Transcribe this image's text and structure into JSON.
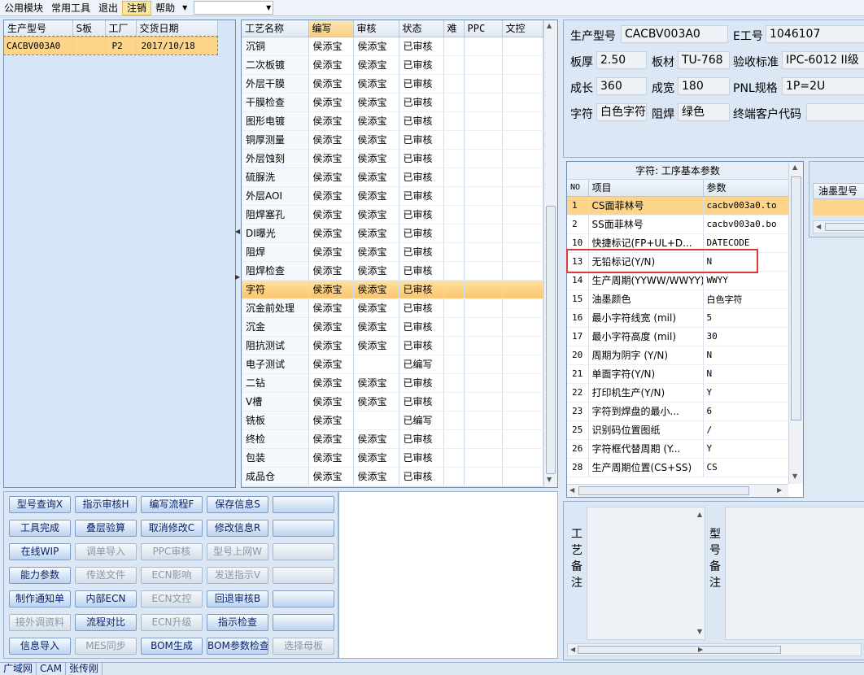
{
  "menu": {
    "items": [
      "公用模块",
      "常用工具",
      "退出",
      "注销",
      "帮助"
    ],
    "active_index": 3,
    "combo_value": ""
  },
  "orders": {
    "columns": [
      "生产型号",
      "S板",
      "工厂",
      "交货日期"
    ],
    "rows": [
      [
        "CACBV003A0",
        "",
        "P2",
        "2017/10/18"
      ]
    ]
  },
  "process": {
    "columns": [
      "工艺名称",
      "编写",
      "审核",
      "状态",
      "难",
      "PPC",
      "文控"
    ],
    "selected_index": 14,
    "rows": [
      [
        "沉铜",
        "侯添宝",
        "侯添宝",
        "已审核",
        "",
        "",
        ""
      ],
      [
        "二次板镀",
        "侯添宝",
        "侯添宝",
        "已审核",
        "",
        "",
        ""
      ],
      [
        "外层干膜",
        "侯添宝",
        "侯添宝",
        "已审核",
        "",
        "",
        ""
      ],
      [
        "干膜检查",
        "侯添宝",
        "侯添宝",
        "已审核",
        "",
        "",
        ""
      ],
      [
        "图形电镀",
        "侯添宝",
        "侯添宝",
        "已审核",
        "",
        "",
        ""
      ],
      [
        "铜厚测量",
        "侯添宝",
        "侯添宝",
        "已审核",
        "",
        "",
        ""
      ],
      [
        "外层蚀刻",
        "侯添宝",
        "侯添宝",
        "已审核",
        "",
        "",
        ""
      ],
      [
        "硫脲洗",
        "侯添宝",
        "侯添宝",
        "已审核",
        "",
        "",
        ""
      ],
      [
        "外层AOI",
        "侯添宝",
        "侯添宝",
        "已审核",
        "",
        "",
        ""
      ],
      [
        "阻焊塞孔",
        "侯添宝",
        "侯添宝",
        "已审核",
        "",
        "",
        ""
      ],
      [
        "DI曝光",
        "侯添宝",
        "侯添宝",
        "已审核",
        "",
        "",
        ""
      ],
      [
        "阻焊",
        "侯添宝",
        "侯添宝",
        "已审核",
        "",
        "",
        ""
      ],
      [
        "阻焊检查",
        "侯添宝",
        "侯添宝",
        "已审核",
        "",
        "",
        ""
      ],
      [
        "字符",
        "侯添宝",
        "侯添宝",
        "已审核",
        "",
        "",
        ""
      ],
      [
        "沉金前处理",
        "侯添宝",
        "侯添宝",
        "已审核",
        "",
        "",
        ""
      ],
      [
        "沉金",
        "侯添宝",
        "侯添宝",
        "已审核",
        "",
        "",
        ""
      ],
      [
        "阻抗测试",
        "侯添宝",
        "侯添宝",
        "已审核",
        "",
        "",
        ""
      ],
      [
        "电子测试",
        "侯添宝",
        "",
        "已编写",
        "",
        "",
        ""
      ],
      [
        "二钻",
        "侯添宝",
        "侯添宝",
        "已审核",
        "",
        "",
        ""
      ],
      [
        "V槽",
        "侯添宝",
        "侯添宝",
        "已审核",
        "",
        "",
        ""
      ],
      [
        "铣板",
        "侯添宝",
        "",
        "已编写",
        "",
        "",
        ""
      ],
      [
        "终检",
        "侯添宝",
        "侯添宝",
        "已审核",
        "",
        "",
        ""
      ],
      [
        "包装",
        "侯添宝",
        "侯添宝",
        "已审核",
        "",
        "",
        ""
      ],
      [
        "成品仓",
        "侯添宝",
        "侯添宝",
        "已审核",
        "",
        "",
        ""
      ]
    ]
  },
  "buttons": [
    {
      "label": "型号查询X",
      "enabled": true
    },
    {
      "label": "指示审核H",
      "enabled": true
    },
    {
      "label": "编写流程F",
      "enabled": true
    },
    {
      "label": "保存信息S",
      "enabled": true
    },
    {
      "label": "",
      "enabled": true
    },
    {
      "label": "工具完成",
      "enabled": true
    },
    {
      "label": "叠层验算",
      "enabled": true
    },
    {
      "label": "取消修改C",
      "enabled": true
    },
    {
      "label": "修改信息R",
      "enabled": true
    },
    {
      "label": "",
      "enabled": true
    },
    {
      "label": "在线WIP",
      "enabled": true
    },
    {
      "label": "调单导入",
      "enabled": false
    },
    {
      "label": "PPC审核",
      "enabled": false
    },
    {
      "label": "型号上网W",
      "enabled": false
    },
    {
      "label": "",
      "enabled": false
    },
    {
      "label": "能力参数",
      "enabled": true
    },
    {
      "label": "传送文件",
      "enabled": false
    },
    {
      "label": "ECN影响",
      "enabled": false
    },
    {
      "label": "发送指示V",
      "enabled": false
    },
    {
      "label": "",
      "enabled": false
    },
    {
      "label": "制作通知单",
      "enabled": true
    },
    {
      "label": "内部ECN",
      "enabled": true
    },
    {
      "label": "ECN文控",
      "enabled": false
    },
    {
      "label": "回退审核B",
      "enabled": true
    },
    {
      "label": "",
      "enabled": true
    },
    {
      "label": "接外调资料",
      "enabled": false
    },
    {
      "label": "流程对比",
      "enabled": true
    },
    {
      "label": "ECN升级",
      "enabled": false
    },
    {
      "label": "指示检查",
      "enabled": true
    },
    {
      "label": "",
      "enabled": true
    },
    {
      "label": "信息导入",
      "enabled": true
    },
    {
      "label": "MES同步",
      "enabled": false
    },
    {
      "label": "BOM生成",
      "enabled": true
    },
    {
      "label": "BOM参数检查",
      "enabled": true
    },
    {
      "label": "选择母板",
      "enabled": false
    }
  ],
  "info": {
    "model_label": "生产型号",
    "model_value": "CACBV003A0",
    "eno_label": "E工号",
    "eno_value": "1046107",
    "thickness_label": "板厚",
    "thickness_value": "2.50",
    "material_label": "板材",
    "material_value": "TU-768",
    "standard_label": "验收标准",
    "standard_value": "IPC-6012 II级",
    "length_label": "成长",
    "length_value": "360",
    "width_label": "成宽",
    "width_value": "180",
    "pnl_label": "PNL规格",
    "pnl_value": "1P=2U",
    "char_label": "字符",
    "char_value": "白色字符",
    "mask_label": "阻焊",
    "mask_value": "绿色",
    "customer_label": "终端客户代码",
    "customer_value": ""
  },
  "params": {
    "title": "字符: 工序基本参数",
    "columns": [
      "NO",
      "项目",
      "参数"
    ],
    "highlight_index": 3,
    "rows": [
      [
        "1",
        "CS面菲林号",
        "cacbv003a0.to"
      ],
      [
        "2",
        "SS面菲林号",
        "cacbv003a0.bo"
      ],
      [
        "10",
        "快捷标记(FP+UL+D...",
        "DATECODE"
      ],
      [
        "13",
        "无铅标记(Y/N)",
        "N"
      ],
      [
        "14",
        "生产周期(YYWW/WWYY)",
        "WWYY"
      ],
      [
        "15",
        "油墨颜色",
        "白色字符"
      ],
      [
        "16",
        "最小字符线宽 (mil)",
        "5"
      ],
      [
        "17",
        "最小字符高度 (mil)",
        "30"
      ],
      [
        "20",
        "周期为阴字 (Y/N)",
        "N"
      ],
      [
        "21",
        "单面字符(Y/N)",
        "N"
      ],
      [
        "22",
        "打印机生产(Y/N)",
        "Y"
      ],
      [
        "23",
        "字符到焊盘的最小...",
        "6"
      ],
      [
        "25",
        "识别码位置图纸",
        "/"
      ],
      [
        "26",
        "字符框代替周期 (Y...",
        "Y"
      ],
      [
        "28",
        "生产周期位置(CS+SS)",
        "CS"
      ]
    ]
  },
  "ink": {
    "column": "油墨型号"
  },
  "remarks": {
    "process_label": "工艺备注",
    "model_label": "型号备注"
  },
  "status": [
    "广域网",
    "CAM",
    "张传刚"
  ]
}
